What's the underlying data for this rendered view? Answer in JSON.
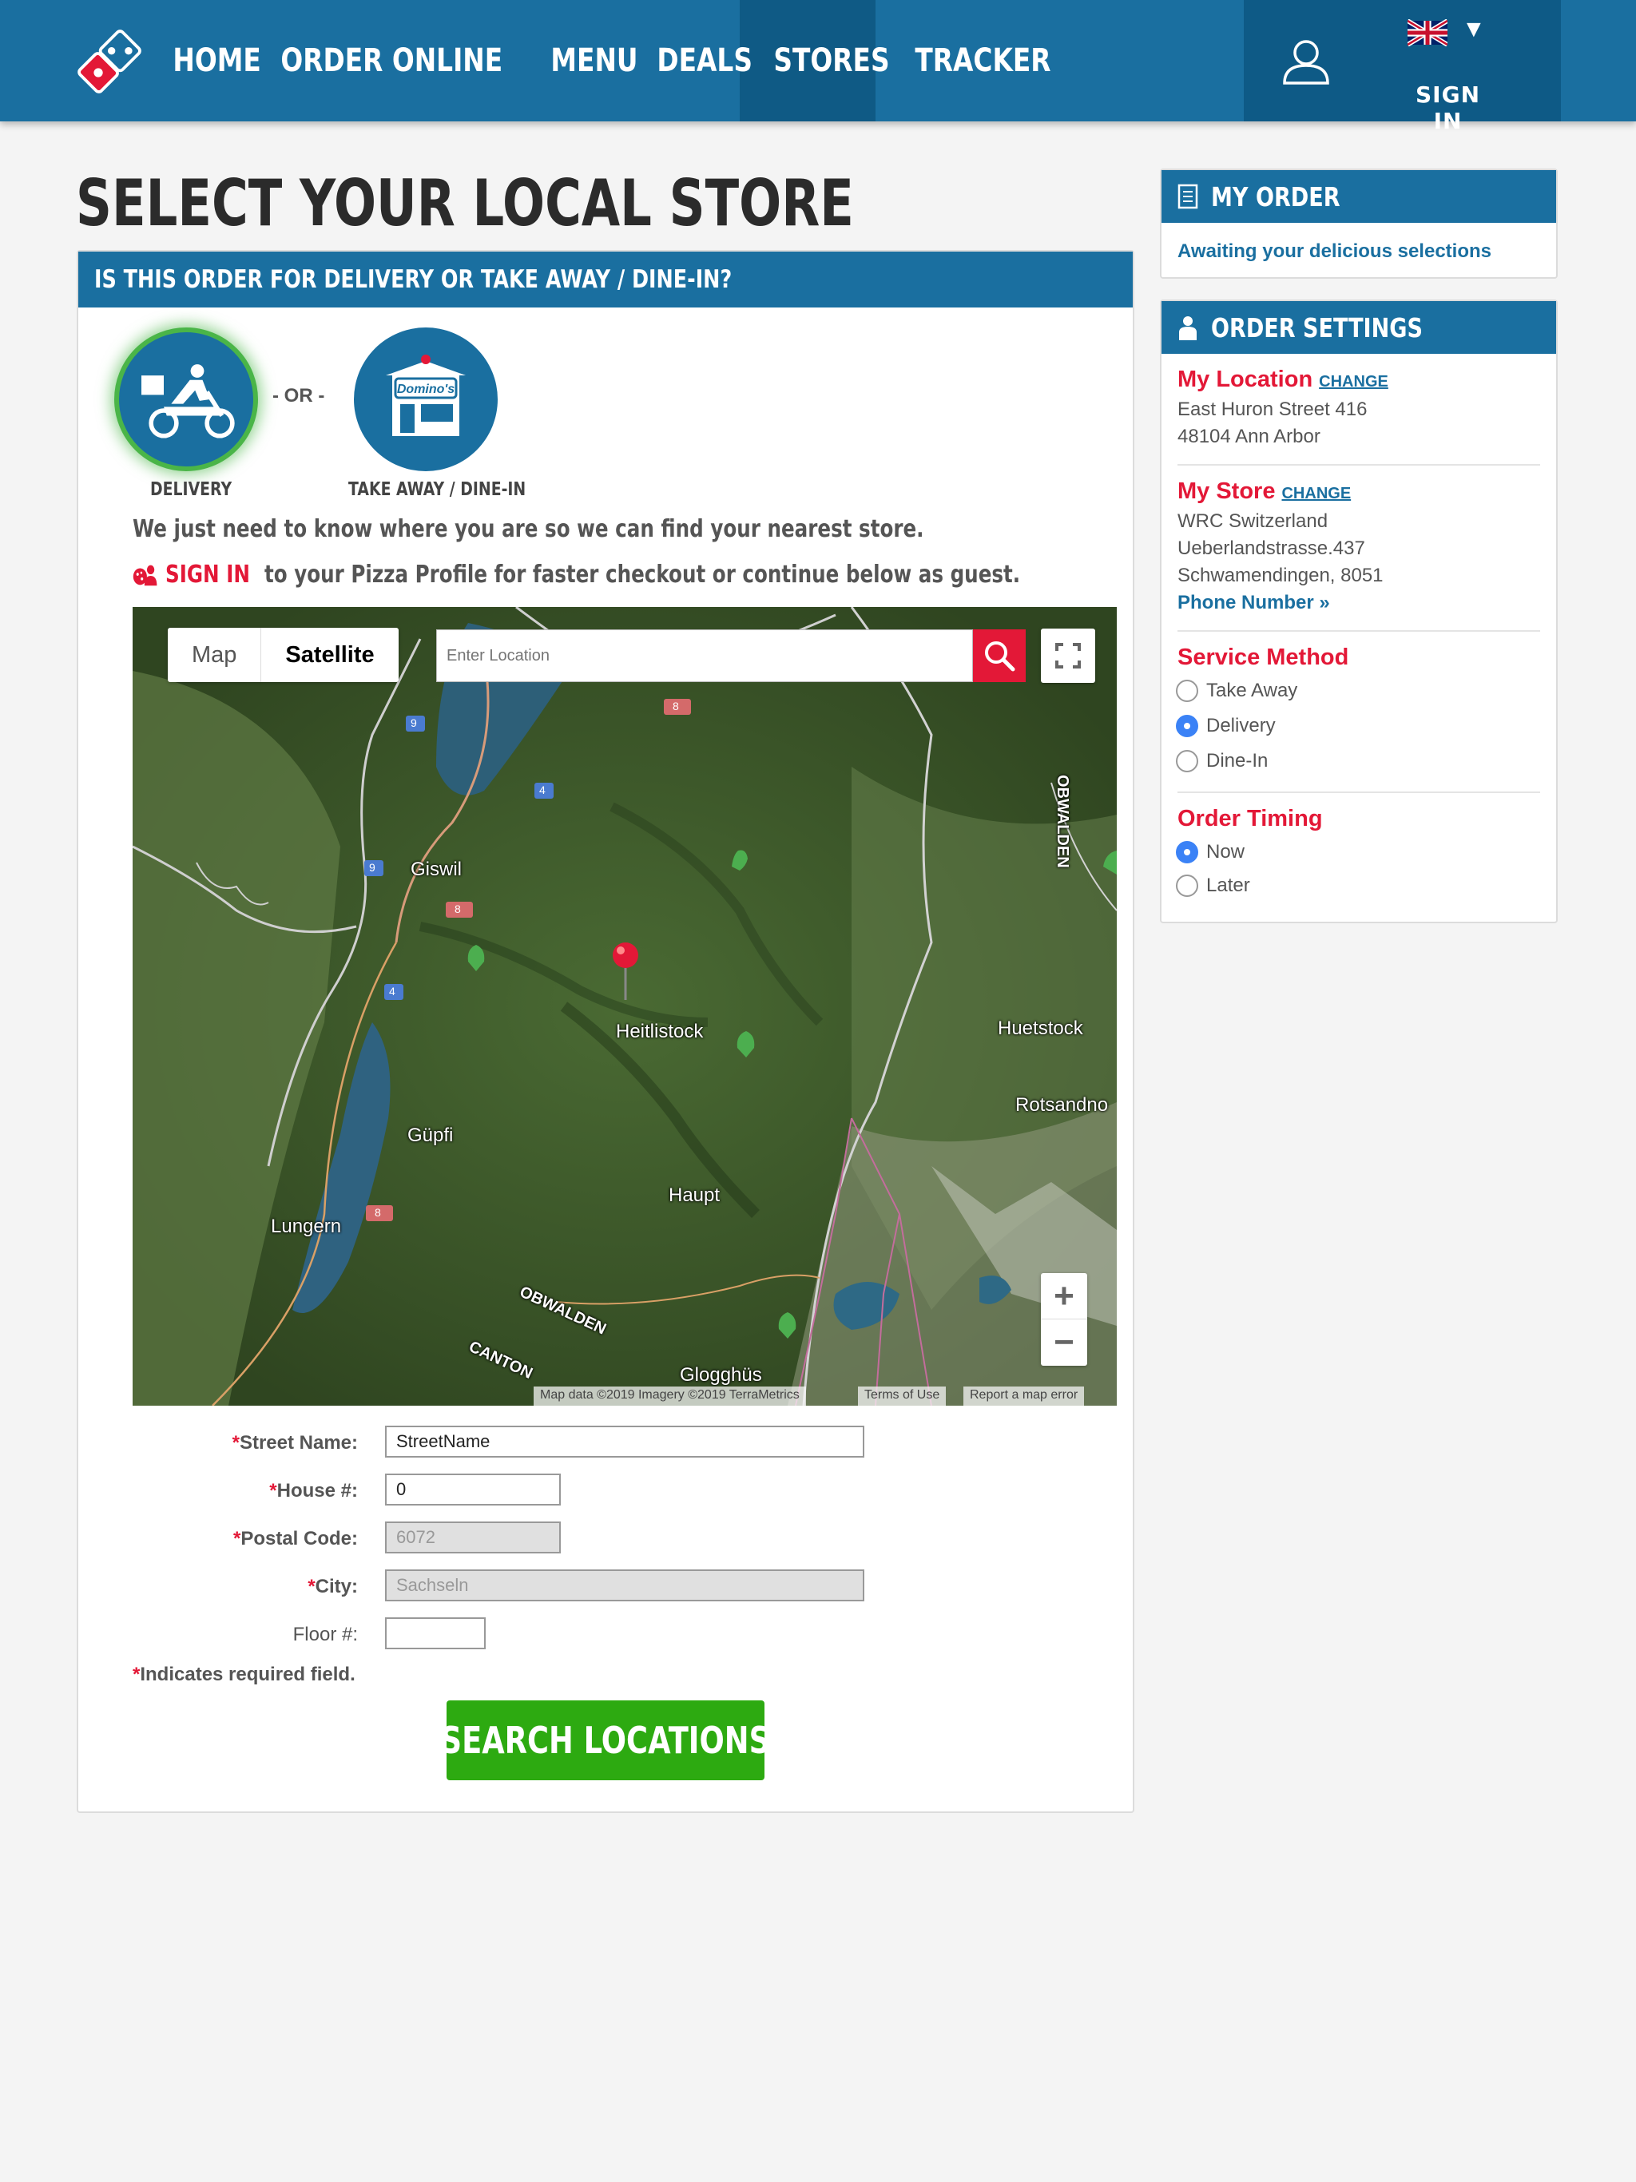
{
  "nav": {
    "items": [
      "HOME",
      "ORDER ONLINE",
      "MENU",
      "DEALS",
      "STORES",
      "TRACKER"
    ],
    "active": "STORES",
    "sign_in": "SIGN IN"
  },
  "page": {
    "title": "SELECT YOUR LOCAL STORE"
  },
  "order_type": {
    "header": "IS THIS ORDER FOR DELIVERY OR TAKE AWAY / DINE-IN?",
    "delivery_label": "DELIVERY",
    "or_text": "- OR -",
    "takeaway_label": "TAKE AWAY / DINE-IN",
    "takeaway_sign": "Domino's",
    "selected": "DELIVERY",
    "intro": "We just need to know where you are so we can find your nearest store.",
    "sign_in_link": "SIGN IN",
    "sign_in_rest": "to your Pizza Profile for faster checkout or continue below as guest."
  },
  "map": {
    "toggle_map": "Map",
    "toggle_satellite": "Satellite",
    "search_placeholder": "Enter Location",
    "zoom_in": "+",
    "zoom_out": "−",
    "labels": {
      "giswil": "Giswil",
      "heitlistock": "Heitlistock",
      "huetstock": "Huetstock",
      "rotsandno": "Rotsandno",
      "guepfi": "Güpfi",
      "haupt": "Haupt",
      "lungern": "Lungern",
      "obwalden_vertical": "OBWALDEN",
      "obwalden": "OBWALDEN",
      "canton": "CANTON",
      "glogghues": "Glogghüs",
      "road_9a": "9",
      "road_9b": "9",
      "road_4a": "4",
      "road_4b": "4",
      "road_8a": "8",
      "road_8b": "8",
      "road_8c": "8"
    },
    "attribution": "Map data ©2019 Imagery ©2019 TerraMetrics",
    "terms": "Terms of Use",
    "report": "Report a map error"
  },
  "form": {
    "street_label": "Street Name:",
    "street_value": "StreetName",
    "house_label": "House #:",
    "house_value": "0",
    "postal_label": "Postal Code:",
    "postal_value": "6072",
    "city_label": "City:",
    "city_value": "Sachseln",
    "floor_label": "Floor #:",
    "floor_value": "",
    "required_mark": "*",
    "required_note": "Indicates required field.",
    "search_button": "SEARCH LOCATIONS"
  },
  "my_order": {
    "title": "MY ORDER",
    "status": "Awaiting your delicious selections"
  },
  "settings": {
    "title": "ORDER SETTINGS",
    "location_title": "My Location",
    "location_change": "CHANGE",
    "location_line1": "East Huron Street 416",
    "location_line2": "48104 Ann Arbor",
    "store_title": "My Store",
    "store_change": "CHANGE",
    "store_line1": "WRC Switzerland",
    "store_line2": "Ueberlandstrasse.437",
    "store_line3": "Schwamendingen, 8051",
    "phone_link": "Phone Number »",
    "service_title": "Service Method",
    "service_options": [
      "Take Away",
      "Delivery",
      "Dine-In"
    ],
    "service_selected": "Delivery",
    "timing_title": "Order Timing",
    "timing_options": [
      "Now",
      "Later"
    ],
    "timing_selected": "Now"
  },
  "colors": {
    "brand_blue": "#1a6fa0",
    "brand_red": "#e31837",
    "cta_green": "#2daa11"
  }
}
